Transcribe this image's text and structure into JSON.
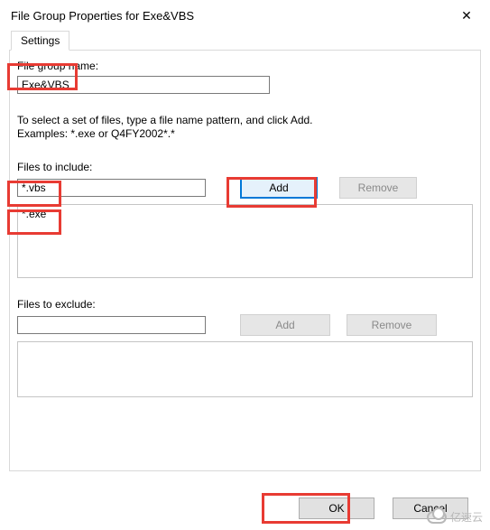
{
  "window": {
    "title": "File Group Properties for Exe&VBS",
    "close_icon": "✕"
  },
  "tabs": {
    "settings": "Settings"
  },
  "labels": {
    "group_name": "File group name:",
    "instructions_line1": "To select a set of files, type a file name pattern, and click Add.",
    "instructions_line2": "Examples: *.exe or Q4FY2002*.*",
    "files_include": "Files to include:",
    "files_exclude": "Files to exclude:"
  },
  "values": {
    "group_name": "Exe&VBS",
    "include_input": "*.vbs",
    "exclude_input": ""
  },
  "include_list": [
    "*.exe"
  ],
  "exclude_list": [],
  "buttons": {
    "add": "Add",
    "remove": "Remove",
    "ok": "OK",
    "cancel": "Cancel"
  },
  "watermark": "亿速云"
}
